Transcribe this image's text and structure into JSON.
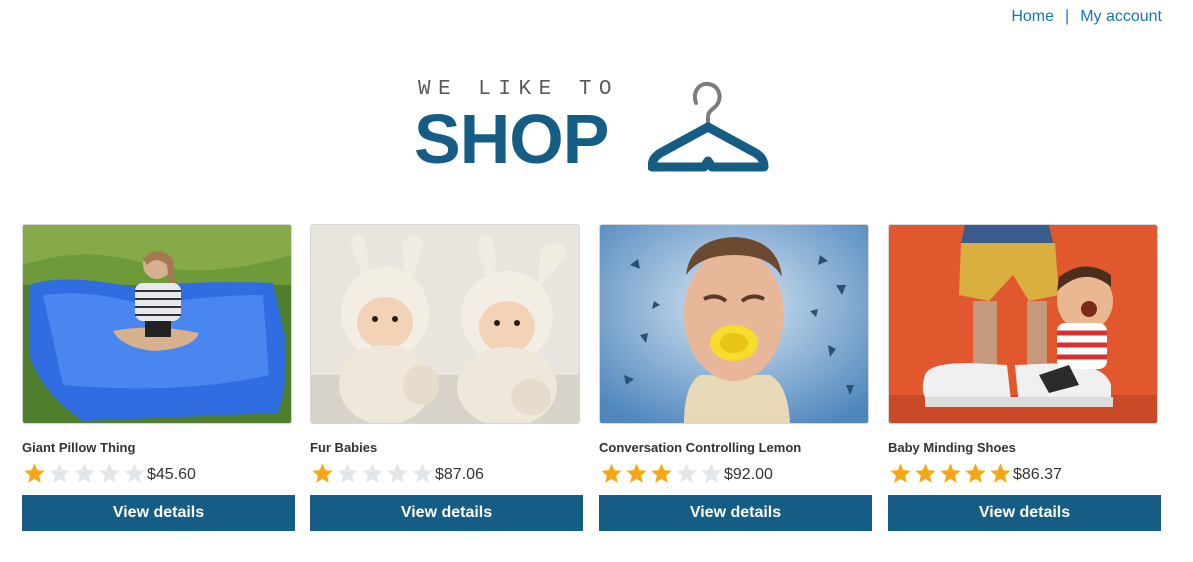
{
  "nav": {
    "home_label": "Home",
    "separator": "|",
    "account_label": "My account"
  },
  "logo": {
    "tagline": "WE LIKE TO",
    "word": "SHOP",
    "icon": "hanger-icon",
    "color": "#155d85"
  },
  "products": [
    {
      "name": "Giant Pillow Thing",
      "rating": 1,
      "max_rating": 5,
      "price": "$45.60",
      "button_label": "View details",
      "image": "blue-bean-bag-photo"
    },
    {
      "name": "Fur Babies",
      "rating": 1,
      "max_rating": 5,
      "price": "$87.06",
      "button_label": "View details",
      "image": "babies-in-bunny-hats-photo"
    },
    {
      "name": "Conversation Controlling Lemon",
      "rating": 3,
      "max_rating": 5,
      "price": "$92.00",
      "button_label": "View details",
      "image": "man-with-lemon-photo"
    },
    {
      "name": "Baby Minding Shoes",
      "rating": 5,
      "max_rating": 5,
      "price": "$86.37",
      "button_label": "View details",
      "image": "figurine-shoes-photo"
    }
  ],
  "colors": {
    "star_filled": "#f6a715",
    "star_empty": "#e1e6ea",
    "button_bg": "#155d85",
    "link": "#1a74b8"
  }
}
